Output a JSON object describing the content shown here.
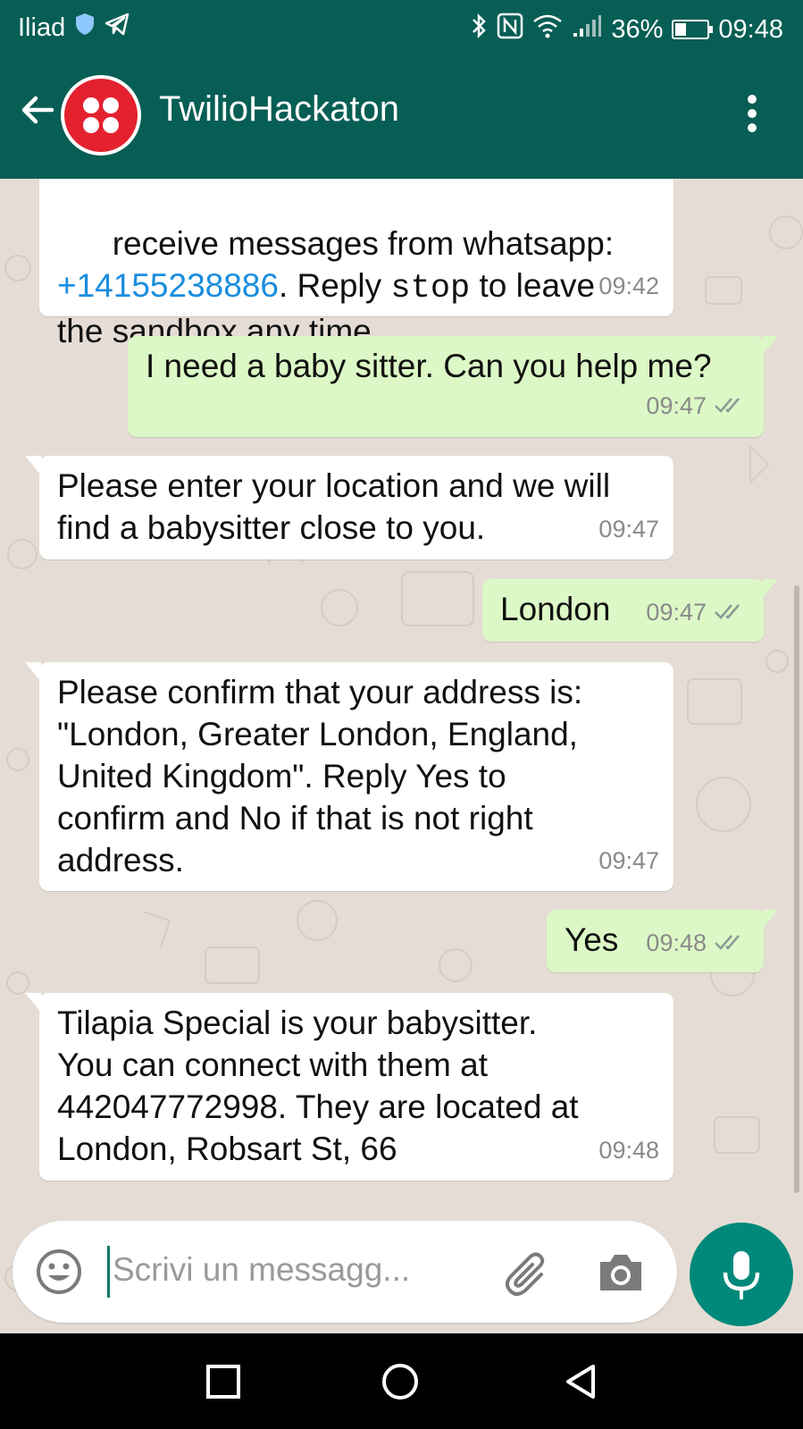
{
  "status_bar": {
    "carrier": "Iliad",
    "battery": "36%",
    "battery_level": 0.36,
    "time": "09:48"
  },
  "app_bar": {
    "title": "TwilioHackaton"
  },
  "messages": [
    {
      "direction": "in",
      "line1": "receive messages from whatsapp:",
      "phone_link": "+14155238886",
      "line2_rest": ". Reply ",
      "mono_word": "stop",
      "line2_end": " to leave",
      "line3": "the sandbox any time.",
      "time": "09:42"
    },
    {
      "direction": "out",
      "text": "I need a baby sitter. Can you help me?",
      "time": "09:47"
    },
    {
      "direction": "in",
      "text": "Please enter your location and we will\nfind a babysitter close to you.",
      "time": "09:47"
    },
    {
      "direction": "out",
      "text": "London",
      "time": "09:47"
    },
    {
      "direction": "in",
      "text": "Please confirm that your address is:\n\"London, Greater London, England,\nUnited Kingdom\". Reply Yes to\nconfirm and No if that is not right\naddress.",
      "time": "09:47"
    },
    {
      "direction": "out",
      "text": "Yes",
      "time": "09:48"
    },
    {
      "direction": "in",
      "text": "Tilapia Special is your babysitter.\nYou can connect with them at\n442047772998. They are located at\nLondon, Robsart St, 66",
      "time": "09:48"
    }
  ],
  "input": {
    "placeholder": "Scrivi un messagg..."
  },
  "colors": {
    "header": "#075e54",
    "outgoing_bubble": "#dcf8c6",
    "incoming_bubble": "#ffffff",
    "accent": "#00897b"
  }
}
